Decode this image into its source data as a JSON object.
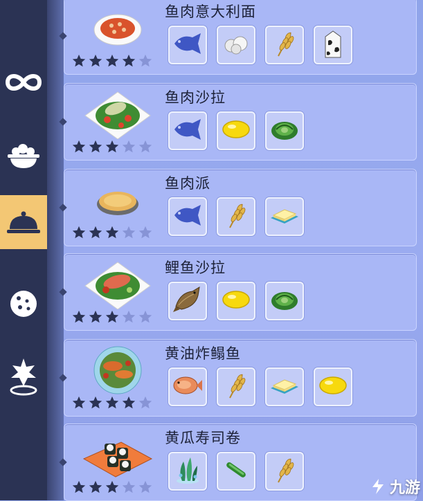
{
  "sidebar": {
    "items": [
      {
        "icon": "infinity-icon"
      },
      {
        "icon": "salad-bowl-icon"
      },
      {
        "icon": "cloche-icon",
        "active": true
      },
      {
        "icon": "cookie-icon"
      },
      {
        "icon": "star-pin-icon"
      }
    ]
  },
  "recipes": [
    {
      "name": "鱼肉意大利面",
      "dish": "pasta-plate",
      "stars": 4,
      "max_stars": 5,
      "ingredients": [
        "fish-icon",
        "garlic-icon",
        "wheat-icon",
        "milk-carton-icon"
      ]
    },
    {
      "name": "鱼肉沙拉",
      "dish": "salad-plate",
      "stars": 3,
      "max_stars": 5,
      "ingredients": [
        "fish-icon",
        "lemon-icon",
        "lettuce-icon"
      ]
    },
    {
      "name": "鱼肉派",
      "dish": "pie-plate",
      "stars": 3,
      "max_stars": 5,
      "ingredients": [
        "fish-icon",
        "wheat-icon",
        "butter-icon"
      ]
    },
    {
      "name": "鲤鱼沙拉",
      "dish": "carp-salad-plate",
      "stars": 3,
      "max_stars": 5,
      "ingredients": [
        "carp-icon",
        "lemon-icon",
        "lettuce-icon"
      ]
    },
    {
      "name": "黄油炸鳎鱼",
      "dish": "fried-sole-plate",
      "stars": 4,
      "max_stars": 5,
      "ingredients": [
        "sole-icon",
        "wheat-icon",
        "butter-icon",
        "lemon-icon"
      ]
    },
    {
      "name": "黄瓜寿司卷",
      "dish": "sushi-plate",
      "stars": 3,
      "max_stars": 5,
      "ingredients": [
        "seaweed-icon",
        "cucumber-icon",
        "wheat-icon"
      ]
    }
  ],
  "watermark": {
    "text": "九游"
  }
}
